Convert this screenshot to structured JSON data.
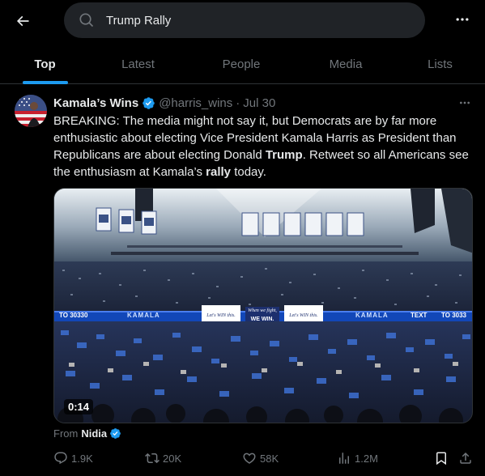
{
  "header": {
    "search_value": "Trump Rally",
    "tabs": [
      {
        "label": "Top",
        "active": true
      },
      {
        "label": "Latest",
        "active": false
      },
      {
        "label": "People",
        "active": false
      },
      {
        "label": "Media",
        "active": false
      },
      {
        "label": "Lists",
        "active": false
      }
    ]
  },
  "tweet": {
    "author_name": "Kamala’s Wins",
    "author_handle": "@harris_wins",
    "separator": "·",
    "date": "Jul 30",
    "text_parts": [
      {
        "text": "BREAKING: The media might not say it, but Democrats are by far more enthusiastic about electing Vice President Kamala Harris as President than Republicans are about electing Donald ",
        "bold": false
      },
      {
        "text": "Trump",
        "bold": true
      },
      {
        "text": ". Retweet so all Americans see the enthusiasm at Kamala’s ",
        "bold": false
      },
      {
        "text": "rally",
        "bold": true
      },
      {
        "text": " today.",
        "bold": false
      }
    ],
    "media": {
      "video_time": "0:14",
      "banner_left": "TO 30330",
      "banner_kamala": "KAMALA",
      "banner_right": "TEXT",
      "banner_right_num": "TO 3033",
      "sign_1": "Let's WIN this.",
      "sign_2_line1": "When we fight,",
      "sign_2_line2": "WE WIN.",
      "sign_3": "Let's WIN this."
    },
    "from_prefix": "From",
    "from_name": "Nidia",
    "actions": {
      "replies": "1.9K",
      "reposts": "20K",
      "likes": "58K",
      "views": "1.2M"
    }
  },
  "colors": {
    "accent": "#1d9bf0",
    "muted": "#71767b",
    "text": "#e7e9ea",
    "background": "#000000"
  }
}
